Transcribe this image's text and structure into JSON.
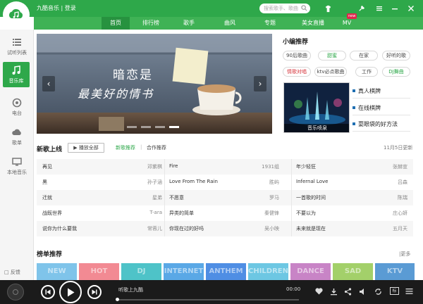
{
  "app": {
    "name": "九酷音乐 | 登录"
  },
  "search": {
    "placeholder": "搜索歌手、歌曲"
  },
  "nav": {
    "tabs": [
      "首页",
      "排行榜",
      "歌手",
      "曲风",
      "专题",
      "美女直播",
      "MV"
    ],
    "active": "首页",
    "new_badge": "new"
  },
  "sidebar": {
    "items": [
      {
        "label": "试听列表",
        "icon": "list-icon"
      },
      {
        "label": "音乐库",
        "icon": "music-note-icon",
        "active": true
      },
      {
        "label": "电台",
        "icon": "radio-icon"
      },
      {
        "label": "歌单",
        "icon": "cloud-icon"
      },
      {
        "label": "本地音乐",
        "icon": "monitor-icon"
      }
    ],
    "feedback": "反馈"
  },
  "banner": {
    "line1": "暗恋是",
    "line2": "最美好的情书",
    "dots": 4,
    "active_dot": 4
  },
  "picks": {
    "title": "小编推荐",
    "tags": [
      {
        "label": "90后歌曲",
        "style": "normal"
      },
      {
        "label": "甜蜜",
        "style": "green"
      },
      {
        "label": "在家",
        "style": "normal"
      },
      {
        "label": "好听的歌",
        "style": "normal"
      },
      {
        "label": "情歌对唱",
        "style": "red"
      },
      {
        "label": "ktv必点歌曲",
        "style": "normal"
      },
      {
        "label": "工作",
        "style": "normal"
      },
      {
        "label": "DJ舞曲",
        "style": "green"
      }
    ],
    "promo_caption": "音乐喷泉",
    "links": [
      "真人棋牌",
      "在线棋牌",
      "耍眼袋的好方法"
    ]
  },
  "new_songs": {
    "title": "新歌上线",
    "play_all": "播放全部",
    "tab_new": "新歌推荐",
    "tab_sep": "|",
    "tab_coop": "合作推荐",
    "date": "11月5日更新",
    "rows": [
      [
        {
          "title": "再见",
          "artist": "邓紫棋"
        },
        {
          "title": "Fire",
          "artist": "1931组"
        },
        {
          "title": "年少轻狂",
          "artist": "张赫宣"
        }
      ],
      [
        {
          "title": "黑",
          "artist": "孙子涵"
        },
        {
          "title": "Love From The Rain",
          "artist": "胜屿"
        },
        {
          "title": "Infernal Love",
          "artist": "吕森"
        }
      ],
      [
        {
          "title": "迁就",
          "artist": "星弟"
        },
        {
          "title": "不愿意",
          "artist": "罗马"
        },
        {
          "title": "一首歌的时间",
          "artist": "陈瑞"
        }
      ],
      [
        {
          "title": "战既世界",
          "artist": "T-ara"
        },
        {
          "title": "异类的简单",
          "artist": "秦健锋"
        },
        {
          "title": "不要以为",
          "artist": "庄心妍"
        }
      ],
      [
        {
          "title": "说你为什么要我",
          "artist": "常蓉儿"
        },
        {
          "title": "你现在过的好吗",
          "artist": "吴小映"
        },
        {
          "title": "未来就是现在",
          "artist": "五月天"
        }
      ]
    ]
  },
  "charts": {
    "title": "榜单推荐",
    "more": "|更多",
    "tiles": [
      {
        "label": "NEW",
        "color": "#7fc4ea"
      },
      {
        "label": "HOT",
        "color": "#f28a93"
      },
      {
        "label": "DJ",
        "color": "#4ec3c8"
      },
      {
        "label": "INTERNET",
        "color": "#5aa8e6"
      },
      {
        "label": "ANTHEM",
        "color": "#4f8ee4"
      },
      {
        "label": "CHILDREN",
        "color": "#6dc7e3"
      },
      {
        "label": "DANCE",
        "color": "#c884c6"
      },
      {
        "label": "SAD",
        "color": "#a3d06a"
      },
      {
        "label": "KTV",
        "color": "#5a9bd4"
      }
    ]
  },
  "player": {
    "now_playing": "听歌上九酷",
    "time": "00:00",
    "progress": 0.0,
    "quality_label": "标"
  },
  "colors": {
    "brand_green": "#2ea84a",
    "nav_active": "#27923f",
    "player_bg": "#1b1b1b"
  }
}
